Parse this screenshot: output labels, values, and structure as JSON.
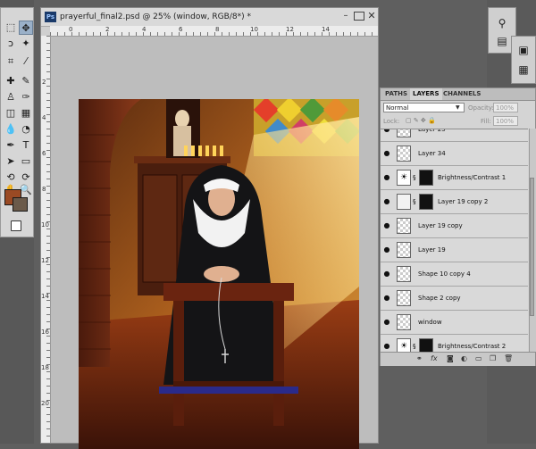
{
  "document": {
    "title": "prayerful_final2.psd @ 25% (window, RGB/8*) *",
    "ps_badge": "Ps",
    "ruler_top_numbers": [
      "0",
      "2",
      "4",
      "6",
      "8",
      "10",
      "12",
      "14"
    ],
    "ruler_left_numbers": [
      "2",
      "4",
      "6",
      "8",
      "10",
      "12",
      "14",
      "16",
      "18",
      "20"
    ]
  },
  "colors": {
    "foreground": "#9a4a24",
    "background": "#6b5a4a"
  },
  "layers_panel": {
    "tabs": [
      "PATHS",
      "LAYERS",
      "CHANNELS"
    ],
    "active_tab": "LAYERS",
    "blend_mode": "Normal",
    "opacity_label": "Opacity:",
    "opacity_value": "100%",
    "lock_label": "Lock:",
    "fill_label": "Fill:",
    "fill_value": "100%",
    "layers": [
      {
        "name": "Layer 25"
      },
      {
        "name": "Layer 34"
      },
      {
        "name": "Brightness/Contrast 1"
      },
      {
        "name": "Layer 19 copy 2"
      },
      {
        "name": "Layer 19 copy"
      },
      {
        "name": "Layer 19"
      },
      {
        "name": "Shape 10 copy 4"
      },
      {
        "name": "Shape 2 copy"
      },
      {
        "name": "window"
      },
      {
        "name": "Brightness/Contrast 2"
      }
    ]
  },
  "icons": {
    "eye": "eye-icon",
    "link": "chain-link-icon"
  }
}
